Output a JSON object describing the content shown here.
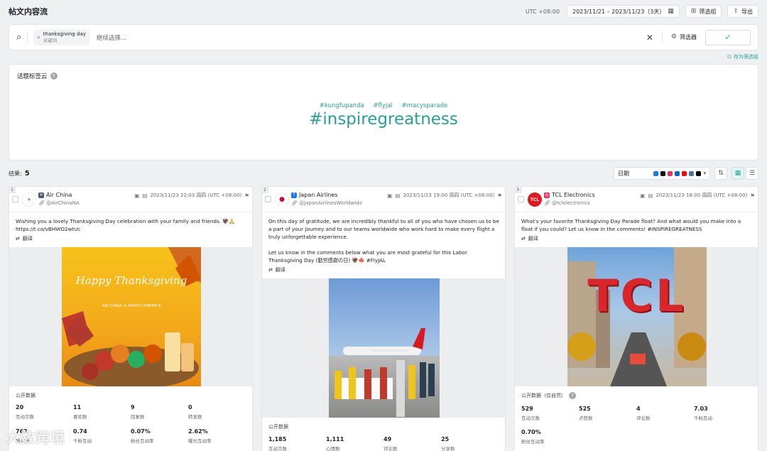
{
  "header": {
    "title": "帖文内容流",
    "timezone": "UTC +08:00",
    "date_range": "2023/11/21 – 2023/11/23（3天）",
    "filter_group_label": "筛选组",
    "export_label": "导出"
  },
  "search": {
    "chip_main": "thanksgiving day",
    "chip_sub": "关键词",
    "placeholder": "继续选择...",
    "filter_label": "筛选器",
    "save_filter_label": "存为筛选组"
  },
  "tag_cloud": {
    "title": "话题标签云",
    "small_tags": [
      "#kungfupanda",
      "#flyjal",
      "#macysparade"
    ],
    "big_tag": "#inspiregreatness",
    "colors": {
      "accent": "#2aa095"
    }
  },
  "results": {
    "label": "结果:",
    "count": "5",
    "sort_label": "日期"
  },
  "cards": [
    {
      "index": "1",
      "account": "Air China",
      "handle": "@AirChinaNA",
      "time": "2023/11/23 22:03 周四 (UTC +08:00)",
      "text": "Wishing you a lovely Thanksgiving Day celebration with your family and friends. 🦃🙏\nhttps://t.co/vBHWO2wtUc",
      "translate": "翻译",
      "image_title": "Happy Thanksgiving",
      "image_sub": "AIR CHINA in NORTH AMERICA",
      "stats_title": "公开数据",
      "stats": [
        {
          "value": "20",
          "label": "互动次数"
        },
        {
          "value": "11",
          "label": "喜欢数"
        },
        {
          "value": "9",
          "label": "回复数"
        },
        {
          "value": "0",
          "label": "转发数"
        },
        {
          "value": "762",
          "label": "曝光数"
        },
        {
          "value": "0.74",
          "label": "千粉互动"
        },
        {
          "value": "0.07%",
          "label": "粉丝互动率"
        },
        {
          "value": "2.62%",
          "label": "曝光互动率"
        }
      ]
    },
    {
      "index": "2",
      "account": "Japan Airlines",
      "handle": "@JapanAirlinesWorldwide",
      "time": "2023/11/23 19:00 周四 (UTC +08:00)",
      "text": "On this day of gratitude, we are incredibly thankful to all of you who have chosen us to be a part of your journey and to our teams worldwide who work hard to make every flight a truly unforgettable experience.\n\nLet us know in the comments below what you are most grateful for this Labor Thanksgiving Day (勤労感謝の日) 🦃🍁 #FlyJAL",
      "translate": "翻译",
      "stats_title": "公开数据",
      "stats": [
        {
          "value": "1,185",
          "label": "互动次数"
        },
        {
          "value": "1,111",
          "label": "心情数"
        },
        {
          "value": "49",
          "label": "评论数"
        },
        {
          "value": "25",
          "label": "分享数"
        }
      ]
    },
    {
      "index": "3",
      "account": "TCL Electronics",
      "handle": "@tclelectronics",
      "time": "2023/11/23 18:00 周四 (UTC +08:00)",
      "text": "What's your favorite Thanksgiving Day Parade float? And what would you make into a float if you could? Let us know in the comments! #INSPIREGREATNESS",
      "translate": "翻译",
      "image_text": "TCL",
      "stats_title": "公开数据（仅自然）",
      "stats": [
        {
          "value": "529",
          "label": "互动次数"
        },
        {
          "value": "525",
          "label": "点赞数"
        },
        {
          "value": "4",
          "label": "评论数"
        },
        {
          "value": "7.03",
          "label": "千粉互动"
        },
        {
          "value": "0.70%",
          "label": "粉丝互动率"
        }
      ]
    }
  ],
  "watermark": "大数跨境"
}
